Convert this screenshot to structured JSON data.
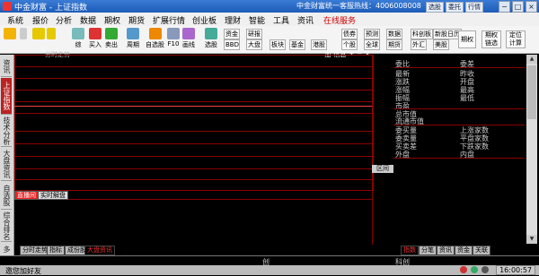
{
  "titlebar": {
    "title": "中金财富 - 上证指数",
    "hotline": "中金财富统一客服热线：4006008008",
    "mini_buttons": [
      "选股",
      "委托",
      "行情"
    ],
    "win_controls": [
      "−",
      "□",
      "×"
    ]
  },
  "menu": [
    "系统",
    "报价",
    "分析",
    "数据",
    "期权",
    "期货",
    "扩展行情",
    "创业板",
    "理财",
    "智能",
    "工具",
    "资讯",
    "在线服务"
  ],
  "toolbar": {
    "buttons": [
      "综",
      "买入",
      "卖出",
      "周期",
      "自选股",
      "F10",
      "画线",
      "选股"
    ],
    "small": [
      "资金",
      "研报",
      "大盘",
      "板块",
      "基金",
      "港股",
      "债券",
      "预测",
      "数据",
      "科创板",
      "新股日历",
      "个股",
      "全球",
      "期货",
      "外汇",
      "美股"
    ],
    "big": [
      "期权",
      "期权\n链选",
      "定位\n计算"
    ]
  },
  "sidebar": [
    "资讯",
    "上证指数",
    "技术分析",
    "大盘资讯",
    "自选股",
    "综合排名",
    "多"
  ],
  "chart": {
    "header_title": "分时走势",
    "header_right": [
      "加",
      "信息",
      "+",
      "−",
      "×"
    ]
  },
  "quote": {
    "rows_left": [
      "委比",
      "最新",
      "涨跌",
      "涨幅",
      "振幅",
      "市盈",
      "总市值",
      "流通市值",
      "委买量",
      "委卖量",
      "买卖差",
      "外盘"
    ],
    "rows_right": [
      "委差",
      "昨收",
      "开盘",
      "最高",
      "最低",
      "",
      "",
      "",
      "上涨家数",
      "平盘家数",
      "下跌家数",
      "内盘"
    ],
    "label": "区间"
  },
  "news_tabs": [
    "直播间",
    "实时解盘"
  ],
  "bottom_tabs": [
    "分时走势",
    "指标",
    "成份股",
    "大盘资讯"
  ],
  "right_tabs": [
    "指数",
    "分笔",
    "资讯",
    "资金",
    "关联"
  ],
  "status": {
    "center": "创",
    "center2": "科创"
  },
  "bottombar": {
    "left": "邀您加好友",
    "clock": "16:00:57"
  }
}
